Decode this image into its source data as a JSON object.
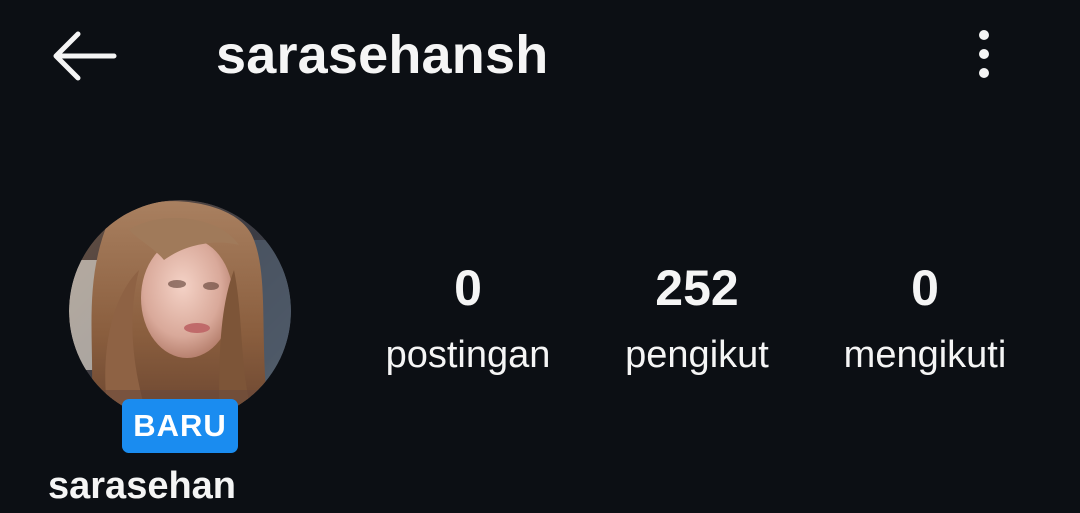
{
  "header": {
    "username": "sarasehansh",
    "back_icon": "arrow-left-icon",
    "more_icon": "more-vertical-icon"
  },
  "profile": {
    "display_name": "sarasehan",
    "badge_label": "BARU",
    "badge_color": "#1a8cf0",
    "avatar_icon": "profile-photo"
  },
  "stats": [
    {
      "value": "0",
      "label": "postingan"
    },
    {
      "value": "252",
      "label": "pengikut"
    },
    {
      "value": "0",
      "label": "mengikuti"
    }
  ],
  "theme": {
    "background": "#0c0f14",
    "text": "#f5f5f5"
  }
}
